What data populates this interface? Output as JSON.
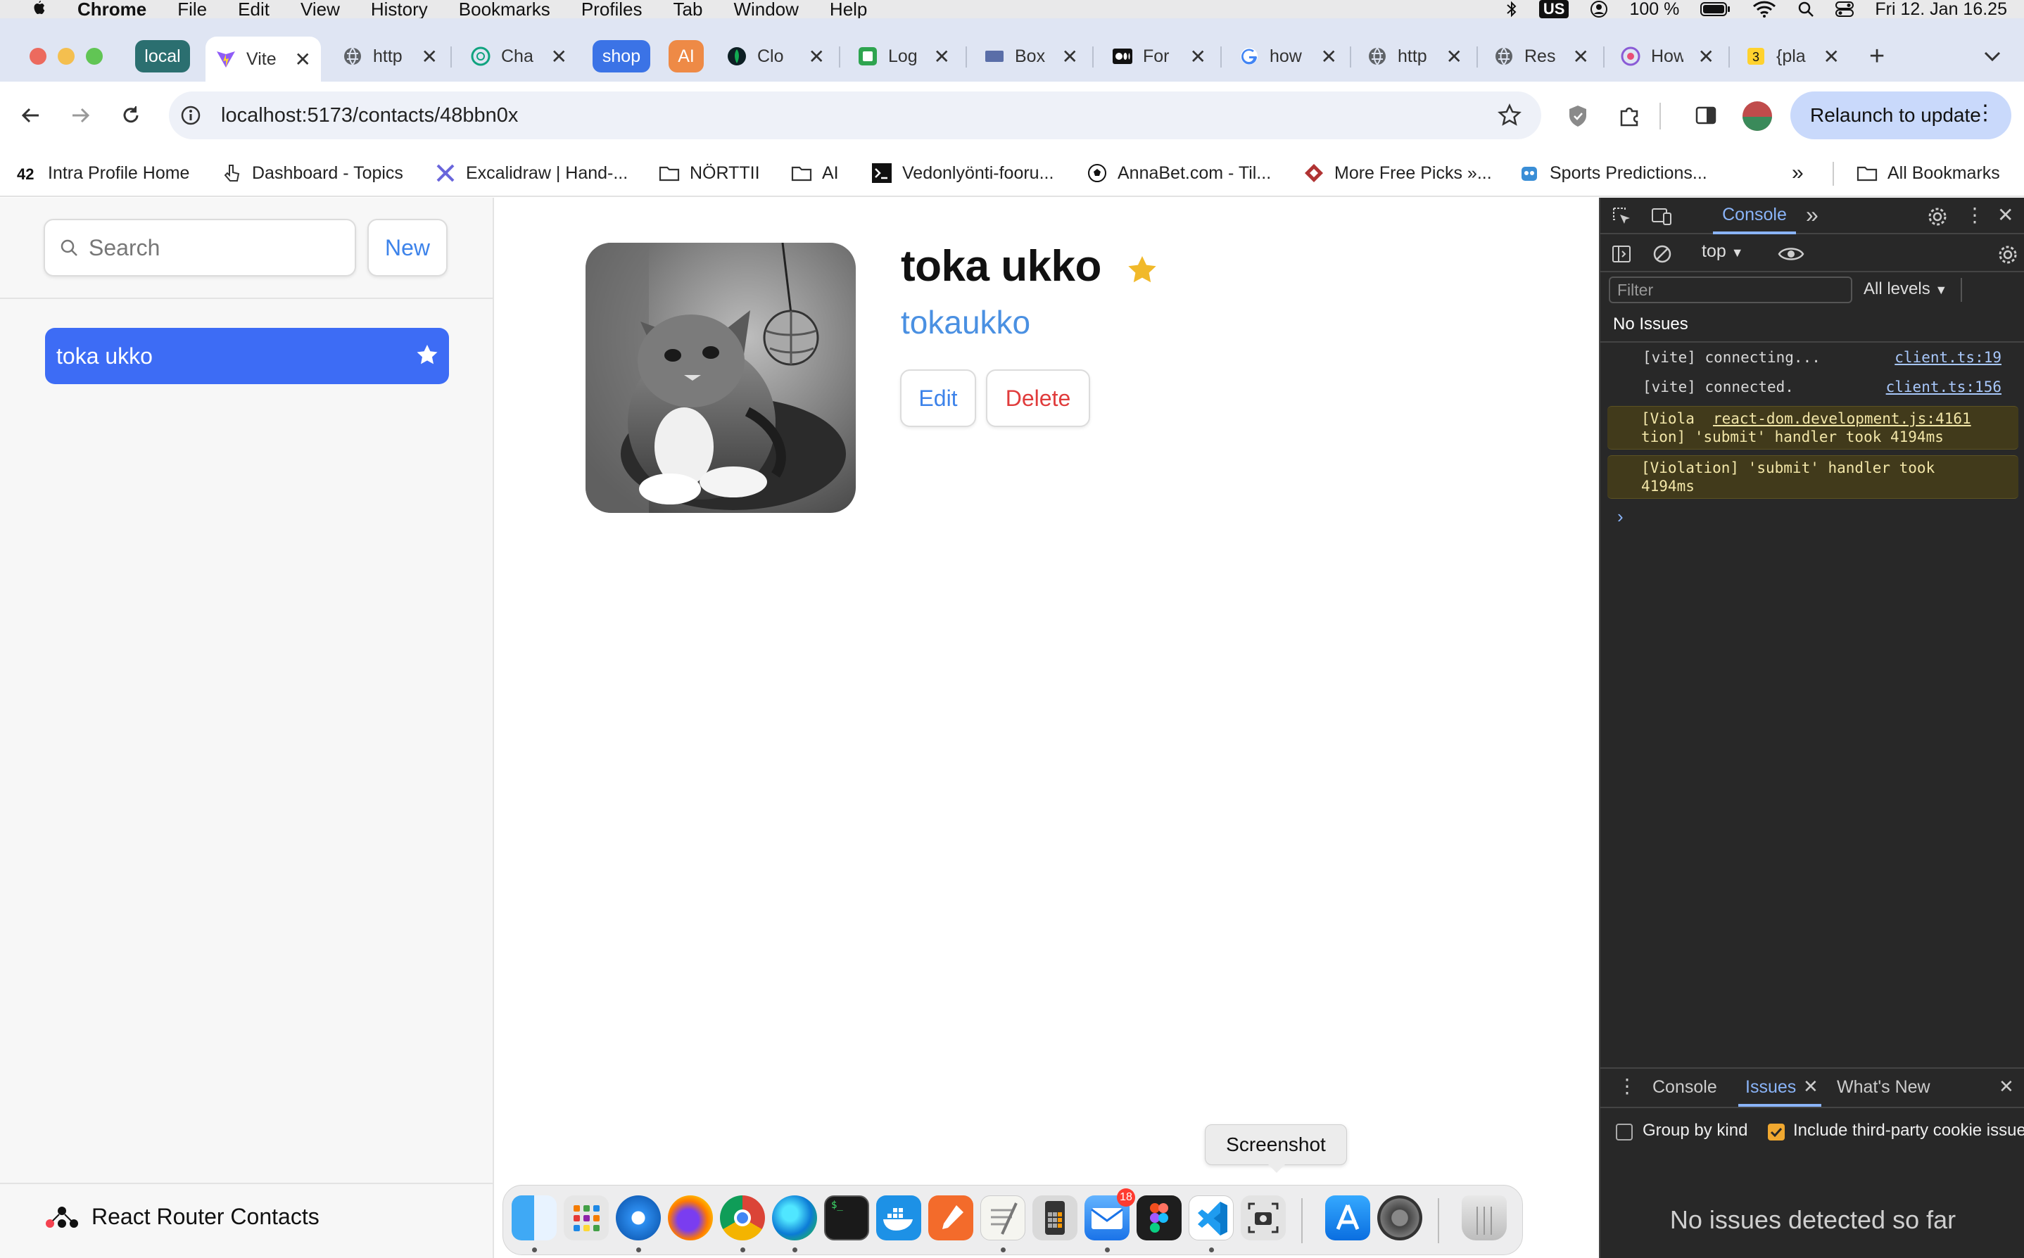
{
  "menubar": {
    "app": "Chrome",
    "items": [
      "File",
      "Edit",
      "View",
      "History",
      "Bookmarks",
      "Profiles",
      "Tab",
      "Window",
      "Help"
    ],
    "keyboard": "US",
    "battery": "100 %",
    "datetime": "Fri 12. Jan  16.25"
  },
  "tabs": {
    "group_local": "local",
    "group_shop": "shop",
    "group_ai": "AI",
    "items": [
      {
        "title": "Vite",
        "active": true
      },
      {
        "title": "http"
      },
      {
        "title": "Cha"
      },
      {
        "title": "Clo"
      },
      {
        "title": "Log"
      },
      {
        "title": "Box"
      },
      {
        "title": "For"
      },
      {
        "title": "how"
      },
      {
        "title": "http"
      },
      {
        "title": "Res"
      },
      {
        "title": "How"
      },
      {
        "title": "{pla"
      }
    ]
  },
  "toolbar": {
    "url": "localhost:5173/contacts/48bbn0x",
    "relaunch": "Relaunch to update"
  },
  "bookmarks": {
    "items": [
      "Intra Profile Home",
      "Dashboard - Topics",
      "Excalidraw | Hand-...",
      "NÖRTTII",
      "AI",
      "Vedonlyönti-fooru...",
      "AnnaBet.com - Til...",
      "More Free Picks »...",
      "Sports Predictions..."
    ],
    "all": "All Bookmarks"
  },
  "sidebar": {
    "search_placeholder": "Search",
    "new_label": "New",
    "contacts": [
      {
        "name": "toka ukko",
        "favorite": true
      }
    ],
    "brand": "React Router Contacts"
  },
  "contact": {
    "name": "toka ukko",
    "handle": "tokaukko",
    "edit_label": "Edit",
    "delete_label": "Delete"
  },
  "devtools": {
    "tab_console": "Console",
    "context": "top",
    "filter_placeholder": "Filter",
    "levels": "All levels",
    "no_issues": "No Issues",
    "logs": [
      {
        "msg": "[vite] connecting...",
        "src": "client.ts:19"
      },
      {
        "msg": "[vite] connected.",
        "src": "client.ts:156"
      }
    ],
    "warn1_line1": "[Viola",
    "warn1_src": "react-dom.development.js:4161",
    "warn1_line2": "tion] 'submit' handler took 4194ms",
    "warn2_line1": "[Violation] 'submit' handler took",
    "warn2_line2": "4194ms",
    "drawer_tabs": {
      "console": "Console",
      "issues": "Issues",
      "whats_new": "What's New"
    },
    "group_by_kind": "Group by kind",
    "include_third_party": "Include third-party cookie issue",
    "no_issues_detected": "No issues detected so far"
  },
  "dock": {
    "tooltip": "Screenshot",
    "mail_badge": "18"
  },
  "colors": {
    "accent": "#3d6cf5",
    "link": "#4a90e2",
    "danger": "#e03c3c",
    "star": "#f1b92a",
    "devtools_bg": "#282828"
  }
}
